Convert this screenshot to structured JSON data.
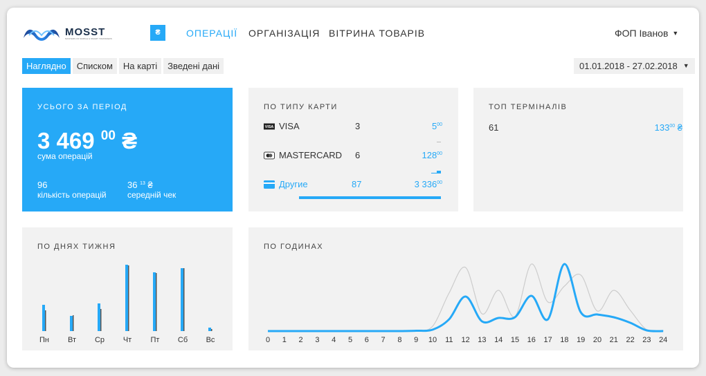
{
  "header": {
    "logo_name": "MOSST",
    "logo_tagline": "MASTERS OF SIMPLE & SMART TRANSFERS",
    "currency_button": "₴",
    "nav": [
      "ОПЕРАЦІЇ",
      "ОРГАНІЗАЦІЯ",
      "ВІТРИНА ТОВАРІВ"
    ],
    "user": "ФОП Іванов"
  },
  "view_tabs": [
    "Наглядно",
    "Списком",
    "На карті",
    "Зведені дані"
  ],
  "active_tab": 0,
  "date_range": "01.01.2018 - 27.02.2018",
  "total_card": {
    "title": "УСЬОГО ЗА ПЕРІОД",
    "sum_int": "3 469",
    "sum_frac": "00",
    "currency": "₴",
    "sum_label": "сума операцій",
    "count_value": "96",
    "count_label": "кількість операцій",
    "avg_int": "36",
    "avg_frac": "13",
    "avg_label": "середній чек"
  },
  "card_type": {
    "title": "ПО ТИПУ КАРТИ",
    "rows": [
      {
        "name": "VISA",
        "count": "3",
        "amount_int": "5",
        "amount_frac": "00",
        "share": 0.0014,
        "icon": "visa-icon"
      },
      {
        "name": "MASTERCARD",
        "count": "6",
        "amount_int": "128",
        "amount_frac": "00",
        "share": 0.037,
        "icon": "mastercard-icon"
      },
      {
        "name": "Другие",
        "count": "87",
        "amount_int": "3 336",
        "amount_frac": "00",
        "share": 0.963,
        "icon": "credit-card-icon"
      }
    ]
  },
  "top_terminals": {
    "title": "ТОП ТЕРМІНАЛІВ",
    "rows": [
      {
        "id": "61",
        "amount_int": "133",
        "amount_frac": "00",
        "currency": "₴"
      }
    ]
  },
  "colors": {
    "accent": "#26a9f7",
    "secondary_line": "#cccccc",
    "dark_bar": "#555555"
  },
  "chart_data": [
    {
      "type": "bar",
      "title": "ПО ДНЯХ ТИЖНЯ",
      "categories": [
        "Пн",
        "Вт",
        "Ср",
        "Чт",
        "Пт",
        "Сб",
        "Вс"
      ],
      "series": [
        {
          "values": [
            38,
            22,
            40,
            96,
            85,
            91,
            5
          ]
        },
        {
          "values": [
            30,
            23,
            32,
            95,
            84,
            91,
            3
          ]
        }
      ],
      "ylim": [
        0,
        100
      ]
    },
    {
      "type": "line",
      "title": "ПО ГОДИНАХ",
      "x": [
        0,
        1,
        2,
        3,
        4,
        5,
        6,
        7,
        8,
        9,
        10,
        11,
        12,
        13,
        14,
        15,
        16,
        17,
        18,
        19,
        20,
        21,
        22,
        23,
        24
      ],
      "series": [
        {
          "values": [
            0,
            0,
            0,
            0,
            0,
            0,
            0,
            0,
            0,
            0.5,
            2,
            17,
            50,
            14,
            19,
            20,
            51,
            17,
            97,
            27,
            24,
            20,
            12,
            1,
            0
          ]
        },
        {
          "values": [
            0,
            0,
            0,
            0,
            0,
            0,
            0,
            0,
            0,
            0.5,
            7,
            55,
            92,
            25,
            59,
            21,
            97,
            42,
            65,
            81,
            29,
            59,
            30,
            2,
            0
          ]
        }
      ],
      "ylim": [
        0,
        100
      ]
    }
  ]
}
